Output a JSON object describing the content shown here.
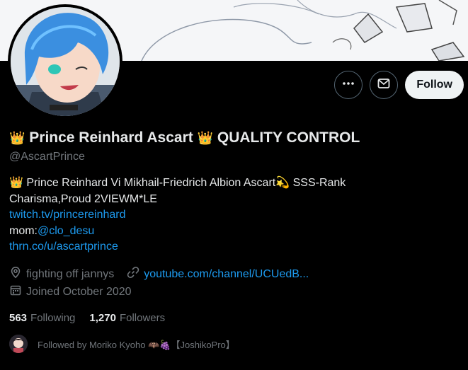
{
  "banner": {
    "description_icon": "sketch-banner"
  },
  "avatar": {
    "icon": "avatar-anime-character"
  },
  "actions": {
    "more_icon": "more-icon",
    "message_icon": "mail-icon",
    "follow_label": "Follow"
  },
  "profile": {
    "crown_emoji": "👑",
    "name_part1": "Prince Reinhard Ascart",
    "name_part2": "QUALITY CONTROL",
    "handle": "@AscartPrince"
  },
  "bio": {
    "line1_crown": "👑",
    "line1_text": "Prince Reinhard Vi Mikhail-Friedrich Albion Ascart",
    "line1_emoji": "💫",
    "line1_suffix": "SSS-Rank",
    "line2": "Charisma,Proud 2VIEWM*LE",
    "link1": "twitch.tv/princereinhard",
    "mom_label": "mom:",
    "mom_link": "@clo_desu",
    "link2": "thrn.co/u/ascartprince"
  },
  "meta": {
    "location": "fighting off jannys",
    "website": "youtube.com/channel/UCUedB...",
    "joined": "Joined October 2020"
  },
  "stats": {
    "following_count": "563",
    "following_label": "Following",
    "followers_count": "1,270",
    "followers_label": "Followers"
  },
  "followed_by": {
    "text": "Followed by Moriko Kyoho",
    "emoji": "🦇🍇",
    "suffix": "【JoshikoPro】"
  },
  "colors": {
    "link": "#1d9bf0",
    "muted": "#71767b",
    "text": "#e7e9ea",
    "background": "#000000"
  }
}
